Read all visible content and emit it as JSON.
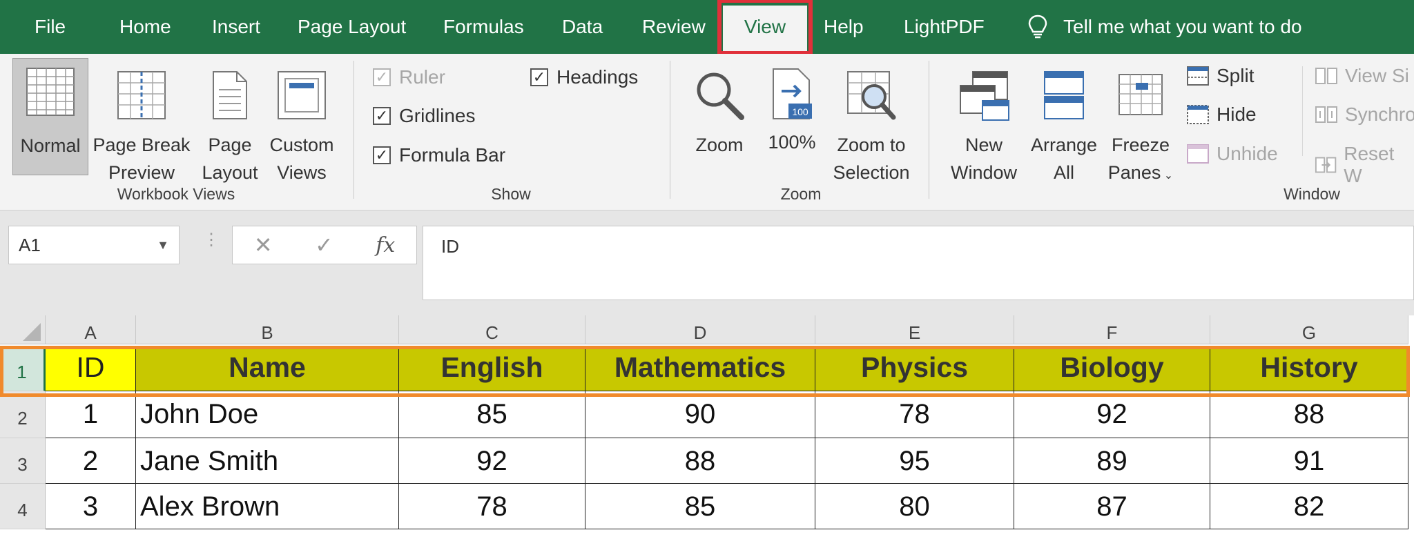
{
  "tabs": [
    {
      "label": "File"
    },
    {
      "label": "Home"
    },
    {
      "label": "Insert"
    },
    {
      "label": "Page Layout"
    },
    {
      "label": "Formulas"
    },
    {
      "label": "Data"
    },
    {
      "label": "Review"
    },
    {
      "label": "View"
    },
    {
      "label": "Help"
    },
    {
      "label": "LightPDF"
    }
  ],
  "active_tab": "View",
  "tell_me": "Tell me what you want to do",
  "ribbon": {
    "workbook_views": {
      "label": "Workbook Views",
      "normal": "Normal",
      "page_break_line1": "Page Break",
      "page_break_line2": "Preview",
      "page_layout_line1": "Page",
      "page_layout_line2": "Layout",
      "custom_views_line1": "Custom",
      "custom_views_line2": "Views"
    },
    "show": {
      "label": "Show",
      "ruler": "Ruler",
      "gridlines": "Gridlines",
      "formula_bar": "Formula Bar",
      "headings": "Headings"
    },
    "zoom": {
      "label": "Zoom",
      "zoom": "Zoom",
      "hundred": "100%",
      "hundred_icon_text": "100",
      "zoom_sel_line1": "Zoom to",
      "zoom_sel_line2": "Selection"
    },
    "window": {
      "label": "Window",
      "new_window_line1": "New",
      "new_window_line2": "Window",
      "arrange_line1": "Arrange",
      "arrange_line2": "All",
      "freeze_line1": "Freeze",
      "freeze_line2": "Panes",
      "split": "Split",
      "hide": "Hide",
      "unhide": "Unhide",
      "view_side": "View Si",
      "synchro": "Synchro",
      "reset": "Reset W"
    }
  },
  "formula_bar": {
    "name_box": "A1",
    "cancel_symbol": "✕",
    "enter_symbol": "✓",
    "fx_symbol": "fx",
    "content": "ID"
  },
  "columns": [
    "A",
    "B",
    "C",
    "D",
    "E",
    "F",
    "G"
  ],
  "rows": [
    "1",
    "2",
    "3",
    "4"
  ],
  "table": {
    "header": [
      "ID",
      "Name",
      "English",
      "Mathematics",
      "Physics",
      "Biology",
      "History"
    ],
    "data": [
      [
        "1",
        "John Doe",
        "85",
        "90",
        "78",
        "92",
        "88"
      ],
      [
        "2",
        "Jane Smith",
        "92",
        "88",
        "95",
        "89",
        "91"
      ],
      [
        "3",
        "Alex Brown",
        "78",
        "85",
        "80",
        "87",
        "82"
      ]
    ]
  },
  "colors": {
    "excel_green": "#217346",
    "header_fill": "#c8c800",
    "id_header_fill": "#ffff00",
    "highlight_red": "#e0303a",
    "highlight_orange": "#f08a2c"
  }
}
